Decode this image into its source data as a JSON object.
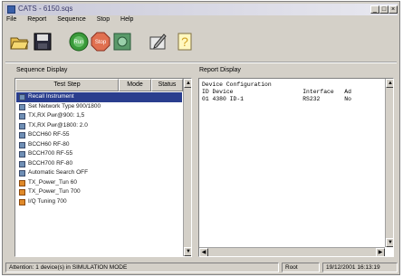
{
  "window": {
    "title": "CATS - 6150.sqs"
  },
  "menu": [
    "File",
    "Report",
    "Sequence",
    "Stop",
    "Help"
  ],
  "toolbar": [
    {
      "name": "open-icon"
    },
    {
      "name": "save-icon"
    },
    {
      "name": "run-icon",
      "label": "Run"
    },
    {
      "name": "stop-icon",
      "label": "Stop"
    },
    {
      "name": "options-icon"
    },
    {
      "name": "edit-icon"
    },
    {
      "name": "help-icon",
      "label": "?"
    }
  ],
  "sequence_panel": {
    "label": "Sequence Display",
    "columns": [
      "Test Step",
      "Mode",
      "Status"
    ],
    "rows": [
      {
        "label": "Recall Instrument",
        "icon": "instrument-icon",
        "selected": true
      },
      {
        "label": "Set Network Type 900/1800",
        "icon": "instrument-icon"
      },
      {
        "label": "TX,RX Pwr@900: 1,5",
        "icon": "instrument-icon"
      },
      {
        "label": "TX,RX Pwr@1800: 2.0",
        "icon": "instrument-icon"
      },
      {
        "label": "BCCH60 RF-55",
        "icon": "instrument-icon"
      },
      {
        "label": "BCCH60 RF-80",
        "icon": "instrument-icon"
      },
      {
        "label": "BCCH700 RF-55",
        "icon": "instrument-icon"
      },
      {
        "label": "BCCH700 RF-80",
        "icon": "instrument-icon"
      },
      {
        "label": "Automatic Search OFF",
        "icon": "instrument-icon"
      },
      {
        "label": "TX_Power_Tun 60",
        "icon": "test-icon"
      },
      {
        "label": "TX_Power_Tun 700",
        "icon": "test-icon"
      },
      {
        "label": "I/Q Tuning 700",
        "icon": "test-icon"
      }
    ]
  },
  "report_panel": {
    "label": "Report Display",
    "lines": [
      "Device Configuration",
      "ID Device                    Interface   Ad",
      "01 4380 ID-1                 RS232       No"
    ]
  },
  "status_bar": {
    "message": "Attention: 1 device(s) in SIMULATION MODE",
    "user": "Root",
    "datetime": "19/12/2001 16:13:19"
  }
}
